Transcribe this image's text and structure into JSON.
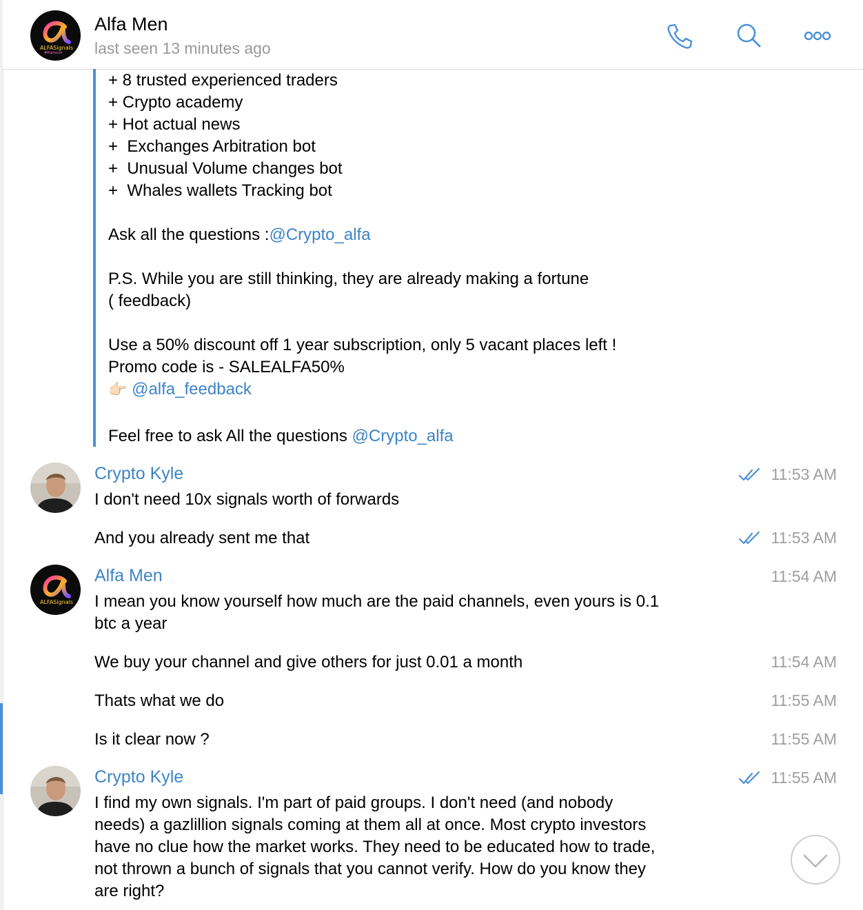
{
  "header": {
    "name": "Alfa Men",
    "status": "last seen 13 minutes ago",
    "logo_text": "ALFASignals",
    "logo_sub": "#Premium"
  },
  "forwarded": {
    "lines": [
      "+ 8 trusted experienced traders",
      "+ Crypto academy",
      "+ Hot actual news",
      "+  Exchanges Arbitration bot",
      "+  Unusual Volume changes bot",
      "+  Whales wallets Tracking bot"
    ],
    "ask_prefix": "Ask all the questions :",
    "ask_link": "@Crypto_alfa",
    "ps_line1": "P.S. While you are still thinking, they are already making a fortune",
    "ps_line2": "( feedback)",
    "discount": "Use a 50% discount off 1 year subscription, only 5 vacant places left !",
    "promo": "Promo code is - SALEALFA50%",
    "feedback_emoji": "👉🏻",
    "feedback_link": "@alfa_feedback",
    "feel_prefix": "Feel free to ask All the questions ",
    "feel_link": "@Crypto_alfa"
  },
  "messages": {
    "kyle1": {
      "sender": "Crypto Kyle",
      "time": "11:53 AM",
      "text": "I don't need 10x signals worth of forwards"
    },
    "kyle2": {
      "time": "11:53 AM",
      "text": "And you already sent me that"
    },
    "alfa1": {
      "sender": "Alfa Men",
      "time": "11:54 AM",
      "line1": "I mean you know yourself how much are the paid channels, even yours is 0.1",
      "line2": "btc a year"
    },
    "alfa2": {
      "time": "11:54 AM",
      "text": "We buy your channel and give others for just 0.01 a month"
    },
    "alfa3": {
      "time": "11:55 AM",
      "text": "Thats what we do"
    },
    "alfa4": {
      "time": "11:55 AM",
      "text": "Is it clear now ?"
    },
    "kyle3": {
      "sender": "Crypto Kyle",
      "time": "11:55 AM",
      "lines": [
        "I find my own signals. I'm part of paid groups. I don't need (and nobody",
        "needs) a gazlillion signals coming at them all at once. Most crypto investors",
        "have no clue how the market works. They need to be educated how to trade,",
        "not thrown a bunch of signals that you cannot verify. How do you know they",
        "are right?"
      ]
    }
  },
  "icons": [
    "phone-icon",
    "search-icon",
    "more-icon",
    "double-check-icon",
    "chevron-down-icon"
  ],
  "colors": {
    "link": "#3d84c6",
    "accent": "#4a90d9",
    "time": "#9e9e9e"
  }
}
